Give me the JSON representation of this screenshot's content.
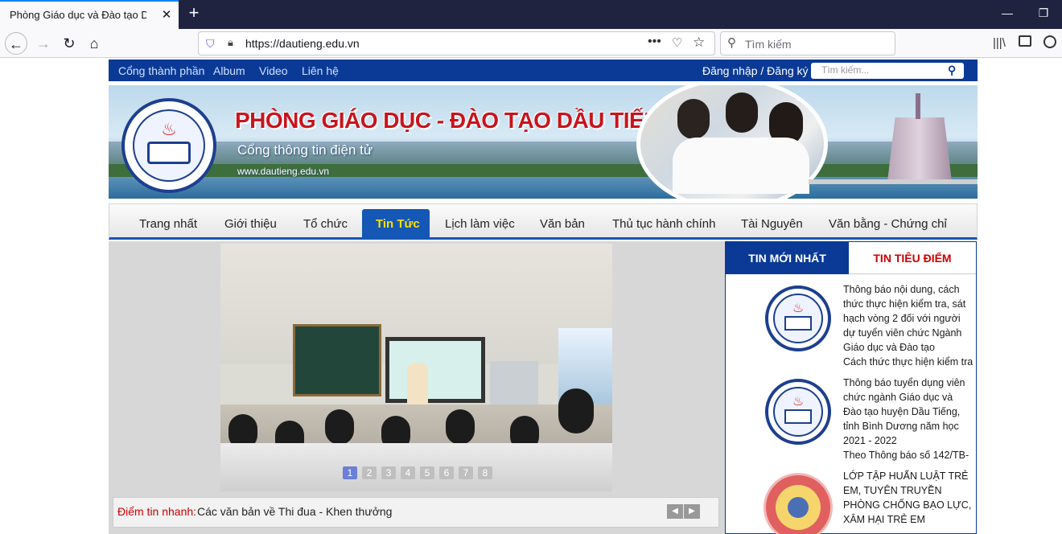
{
  "browser": {
    "tab_title": "Phòng Giáo dục và Đào tạo Dầu",
    "url": "https://dautieng.edu.vn",
    "search_placeholder": "Tìm kiếm"
  },
  "site": {
    "top_links": [
      "Cổng thành phần",
      "Album",
      "Video",
      "Liên hệ"
    ],
    "login_text": "Đăng nhập / Đăng ký",
    "search_placeholder": "Tìm kiếm...",
    "banner_title": "PHÒNG GIÁO DỤC - ĐÀO TẠO DẦU TIẾNG",
    "banner_subtitle": "Cổng thông tin điện tử",
    "banner_url": "www.dautieng.edu.vn",
    "menu": [
      "Trang nhất",
      "Giới thiệu",
      "Tổ chức",
      "Tin Tức",
      "Lịch làm việc",
      "Văn bản",
      "Thủ tục hành chính",
      "Tài Nguyên",
      "Văn bằng - Chứng chỉ"
    ],
    "active_menu": "Tin Tức",
    "slider_pages": [
      "1",
      "2",
      "3",
      "4",
      "5",
      "6",
      "7",
      "8"
    ],
    "quick_news_label": "Điểm tin nhanh:",
    "quick_news_text": "Các văn bản về Thi đua - Khen thưởng",
    "tab_latest": "TIN MỚI NHẤT",
    "tab_focus": "TIN TIÊU ĐIỂM",
    "news": [
      {
        "title": "Thông báo nội dung, cách thức thực hiện kiểm tra, sát hạch vòng 2 đối với người dự tuyển viên chức Ngành Giáo dục và Đào tạo",
        "summary": "Cách thức thực hiện kiểm tra"
      },
      {
        "title": "Thông báo tuyển dụng viên chức ngành Giáo dục và Đào tạo huyện Dầu Tiếng, tỉnh Bình Dương năm học 2021 - 2022",
        "summary": "Theo Thông báo số 142/TB-"
      },
      {
        "title": "LỚP TẬP HUẤN LUẬT TRẺ EM, TUYÊN TRUYỀN PHÒNG CHỐNG BẠO LỰC, XÂM HẠI TRẺ EM",
        "summary": ""
      }
    ]
  }
}
